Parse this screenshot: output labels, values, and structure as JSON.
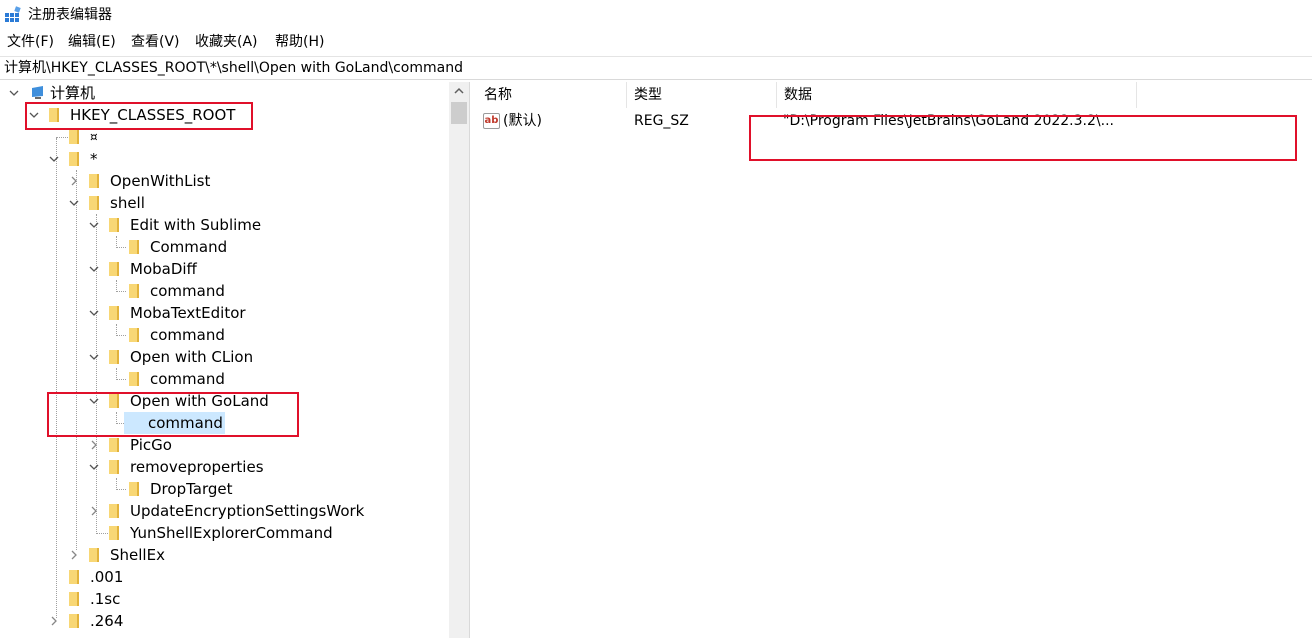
{
  "window": {
    "title": "注册表编辑器"
  },
  "menu": [
    "文件(F)",
    "编辑(E)",
    "查看(V)",
    "收藏夹(A)",
    "帮助(H)"
  ],
  "address": "计算机\\HKEY_CLASSES_ROOT\\*\\shell\\Open with GoLand\\command",
  "tree": {
    "root": "计算机",
    "hkcr": "HKEY_CLASSES_ROOT",
    "blank_child": "¤",
    "star": "*",
    "openwithlist": "OpenWithList",
    "shell": "shell",
    "edit_sublime": "Edit with Sublime",
    "edit_sublime_cmd": "Command",
    "mobadiff": "MobaDiff",
    "mobadiff_cmd": "command",
    "mobatext": "MobaTextEditor",
    "mobatext_cmd": "command",
    "clion": "Open with CLion",
    "clion_cmd": "command",
    "goland": "Open with GoLand",
    "goland_cmd": "command",
    "picgo": "PicGo",
    "removeprops": "removeproperties",
    "droptarget": "DropTarget",
    "updateenc": "UpdateEncryptionSettingsWork",
    "yunshell": "YunShellExplorerCommand",
    "shellex": "ShellEx",
    "ext001": ".001",
    "ext1sc": ".1sc",
    "ext264": ".264"
  },
  "columns": {
    "name": "名称",
    "type": "类型",
    "data": "数据"
  },
  "values": [
    {
      "name": "(默认)",
      "type": "REG_SZ",
      "data": "\"D:\\Program Files\\JetBrains\\GoLand 2022.3.2\\..."
    }
  ],
  "icons": {
    "value_icon": "ab",
    "app_icon": "registry-editor-icon"
  },
  "colors": {
    "selection": "#cce8ff",
    "folder": "#f8d775",
    "highlight_box": "#e0102a"
  }
}
